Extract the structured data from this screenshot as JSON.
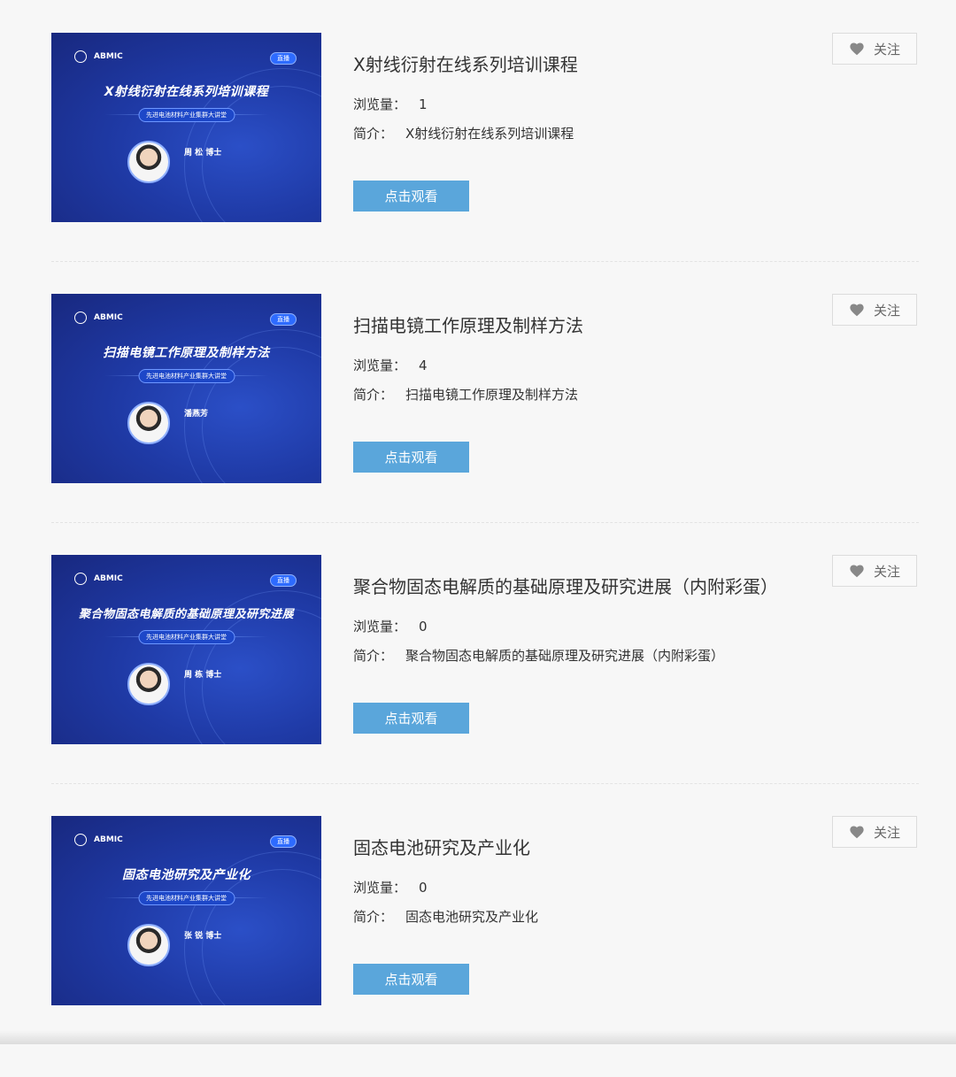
{
  "colors": {
    "watch_button_bg": "#5aa6db",
    "page_bg": "#f7f7f7",
    "poster_bg": "#1f3aa6"
  },
  "icons": {
    "follow": "heart-icon"
  },
  "items": [
    {
      "title": "X射线衍射在线系列培训课程",
      "views_label": "浏览量：",
      "views": "1",
      "intro_label": "简介：",
      "intro": "X射线衍射在线系列培训课程",
      "watch_label": "点击观看",
      "follow_label": "关注",
      "poster": {
        "org": "ABMIC",
        "live": "直播",
        "title": "X射线衍射在线系列培训课程",
        "series": "先进电池材料产业集群大讲堂",
        "speaker": "周 松 博士"
      }
    },
    {
      "title": "扫描电镜工作原理及制样方法",
      "views_label": "浏览量：",
      "views": "4",
      "intro_label": "简介：",
      "intro": "扫描电镜工作原理及制样方法",
      "watch_label": "点击观看",
      "follow_label": "关注",
      "poster": {
        "org": "ABMIC",
        "live": "直播",
        "title": "扫描电镜工作原理及制样方法",
        "series": "先进电池材料产业集群大讲堂",
        "speaker": "潘燕芳"
      }
    },
    {
      "title": "聚合物固态电解质的基础原理及研究进展（内附彩蛋）",
      "views_label": "浏览量：",
      "views": "0",
      "intro_label": "简介：",
      "intro": "聚合物固态电解质的基础原理及研究进展（内附彩蛋）",
      "watch_label": "点击观看",
      "follow_label": "关注",
      "poster": {
        "org": "ABMIC",
        "live": "直播",
        "title": "聚合物固态电解质的基础原理及研究进展",
        "series": "先进电池材料产业集群大讲堂",
        "speaker": "周 栋 博士"
      }
    },
    {
      "title": "固态电池研究及产业化",
      "views_label": "浏览量：",
      "views": "0",
      "intro_label": "简介：",
      "intro": "固态电池研究及产业化",
      "watch_label": "点击观看",
      "follow_label": "关注",
      "poster": {
        "org": "ABMIC",
        "live": "直播",
        "title": "固态电池研究及产业化",
        "series": "先进电池材料产业集群大讲堂",
        "speaker": "张 锐 博士"
      }
    }
  ]
}
